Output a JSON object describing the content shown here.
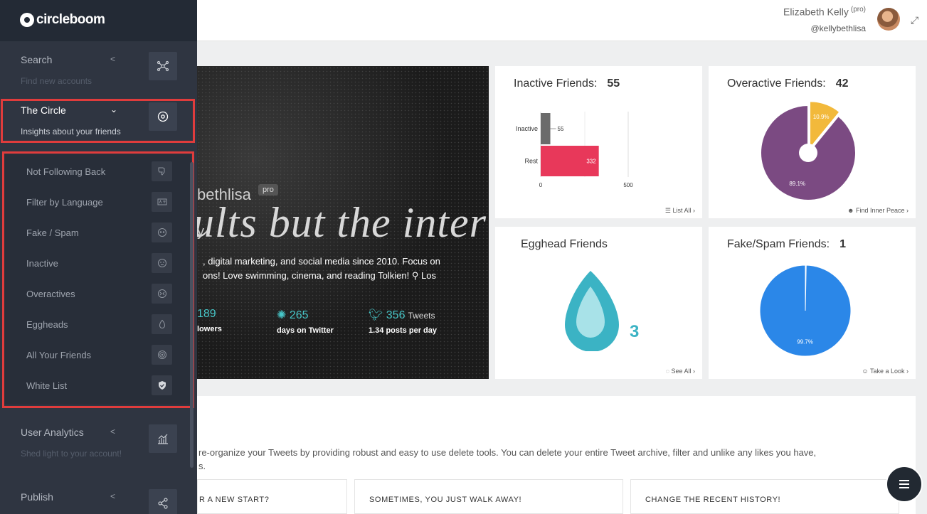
{
  "app": {
    "logo_text": "circleboom"
  },
  "header": {
    "user_name": "Elizabeth Kelly",
    "user_badge": "(pro)",
    "user_handle": "@kellybethlisa"
  },
  "sidebar": {
    "sections": [
      {
        "title": "Search",
        "subtitle": "Find new accounts",
        "icon": "network-icon"
      },
      {
        "title": "The Circle",
        "subtitle": "Insights about your friends",
        "icon": "target-icon"
      },
      {
        "title": "User Analytics",
        "subtitle": "Shed light to your account!",
        "icon": "chart-icon"
      },
      {
        "title": "Publish",
        "subtitle": "",
        "icon": "share-icon"
      }
    ],
    "circle_items": [
      {
        "label": "Not Following Back",
        "icon": "thumbs-down-icon"
      },
      {
        "label": "Filter by Language",
        "icon": "language-icon"
      },
      {
        "label": "Fake / Spam",
        "icon": "mask-icon"
      },
      {
        "label": "Inactive",
        "icon": "sleepy-face-icon"
      },
      {
        "label": "Overactives",
        "icon": "hyper-icon"
      },
      {
        "label": "Eggheads",
        "icon": "egg-icon"
      },
      {
        "label": "All Your Friends",
        "icon": "target-icon"
      },
      {
        "label": "White List",
        "icon": "shield-check-icon"
      }
    ]
  },
  "profile_banner": {
    "handle_fragment": "bethlisa",
    "pro_badge": "pro",
    "script_text": "ults but the inter",
    "small_fragment": "y",
    "bio_line1": ", digital marketing, and social media since 2010. Focus on",
    "bio_line2": "ons! Love swimming, cinema, and reading Tolkien!",
    "bio_location": "Los",
    "stats": [
      {
        "value": "189",
        "label": "lowers"
      },
      {
        "value": "265",
        "label": "days on Twitter"
      },
      {
        "value": "356",
        "unit": "Tweets",
        "label": "1.34 posts per day"
      }
    ]
  },
  "cards": {
    "inactive": {
      "title": "Inactive Friends:",
      "count": "55",
      "link": "List All",
      "chart": {
        "type": "bar",
        "categories": [
          "Inactive",
          "Rest"
        ],
        "values": [
          55,
          332
        ],
        "xlim": [
          0,
          500
        ],
        "xticks": [
          "0",
          "500"
        ],
        "colors": [
          "#6b6b6b",
          "#e8385a"
        ]
      }
    },
    "overactive": {
      "title": "Overactive Friends:",
      "count": "42",
      "link": "Find Inner Peace",
      "chart": {
        "type": "pie",
        "values": [
          10.9,
          89.1
        ],
        "labels": [
          "10.9%",
          "89.1%"
        ],
        "colors": [
          "#f2b93b",
          "#7b4a82"
        ]
      }
    },
    "egghead": {
      "title": "Egghead Friends",
      "count": "3",
      "link": "See All"
    },
    "fakespam": {
      "title": "Fake/Spam Friends:",
      "count": "1",
      "link": "Take a Look",
      "chart": {
        "type": "pie",
        "values": [
          0.3,
          99.7
        ],
        "labels": [
          "",
          "99.7%"
        ],
        "colors": [
          "#ffffff",
          "#2b87e8"
        ]
      }
    }
  },
  "chart_data": [
    {
      "type": "bar",
      "categories": [
        "Inactive",
        "Rest"
      ],
      "values": [
        55,
        332
      ],
      "xlim": [
        0,
        500
      ]
    },
    {
      "type": "pie",
      "categories": [
        "",
        ""
      ],
      "values": [
        10.9,
        89.1
      ]
    },
    {
      "type": "pie",
      "categories": [
        "",
        ""
      ],
      "values": [
        0.3,
        99.7
      ]
    }
  ],
  "bottom": {
    "text_line1": "re-organize your Tweets by providing robust and easy to use delete tools. You can delete your entire Tweet archive, filter and unlike any likes you have,",
    "text_line2": "s.",
    "boxes": [
      "R A NEW START?",
      "SOMETIMES, YOU JUST WALK AWAY!",
      "CHANGE THE RECENT HISTORY!"
    ]
  }
}
